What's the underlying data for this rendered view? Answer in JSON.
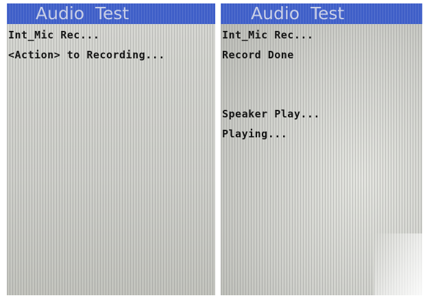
{
  "screens": [
    {
      "title": "Audio  Test",
      "lines": [
        "Int_Mic Rec...",
        "<Action> to Recording..."
      ]
    },
    {
      "title": "Audio  Test",
      "lines": [
        "Int_Mic Rec...",
        "Record Done",
        "Speaker Play...",
        "Playing..."
      ]
    }
  ],
  "colors": {
    "titlebar": "#3f5fc8",
    "title_text": "#c9cfe6",
    "screen_bg": "#cfd0cb",
    "text": "#141414"
  }
}
